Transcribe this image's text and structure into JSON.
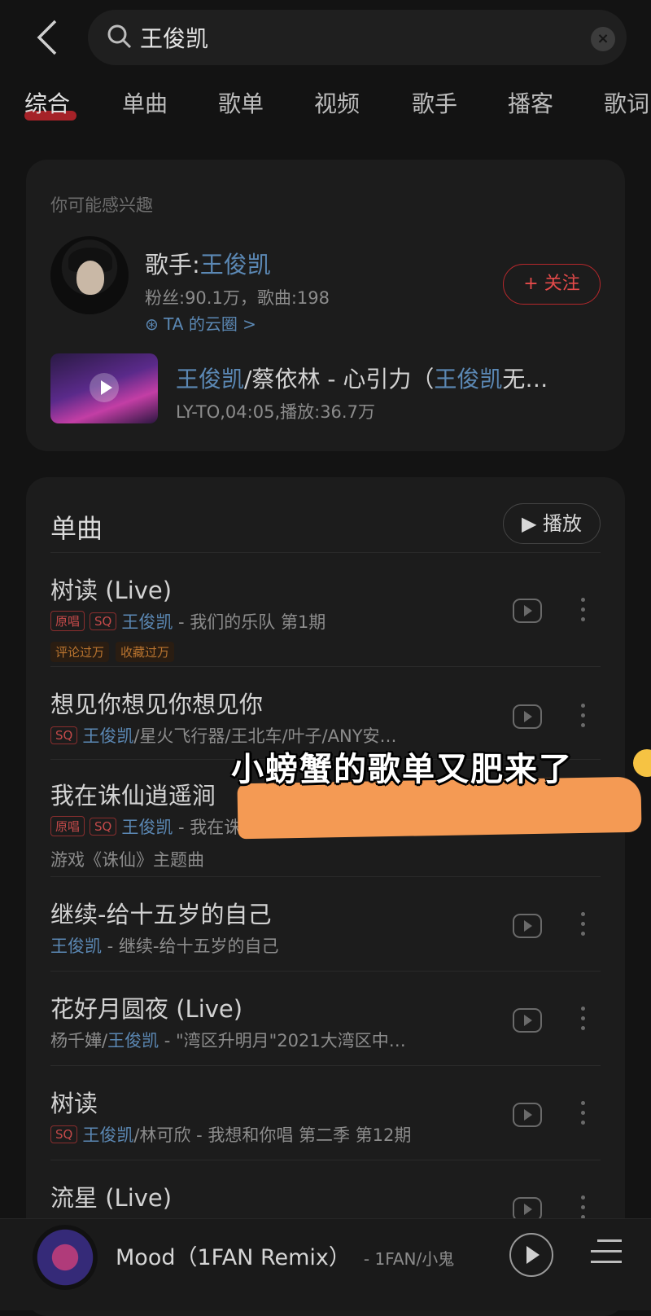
{
  "search": {
    "query": "王俊凯"
  },
  "tabs": [
    "综合",
    "单曲",
    "歌单",
    "视频",
    "歌手",
    "播客",
    "歌词"
  ],
  "interest": {
    "heading": "你可能感兴趣",
    "artist_prefix": "歌手:",
    "artist_name": "王俊凯",
    "artist_stats": "粉丝:90.1万，歌曲:198",
    "circle_link": "TA 的云圈 >",
    "follow_label": "+ 关注",
    "video": {
      "title_a": "王俊凯",
      "title_b": "/蔡依林 - 心引力（",
      "title_c": "王俊凯",
      "title_d": "无…",
      "meta": "LY-TO,04:05,播放:36.7万"
    }
  },
  "songs_section": {
    "heading": "单曲",
    "play_all_label": "▶ 播放",
    "songs": [
      {
        "title": "树读 (Live)",
        "tags": [
          "原唱",
          "SQ"
        ],
        "artist": "王俊凯",
        "rest": " - 我们的乐队 第1期",
        "badges": [
          "评论过万",
          "收藏过万"
        ]
      },
      {
        "title": "想见你想见你想见你",
        "tags": [
          "SQ"
        ],
        "artist": "王俊凯",
        "rest": "/星火飞行器/王北车/叶子/ANY安…"
      },
      {
        "title": "我在诛仙逍遥涧",
        "tags": [
          "原唱",
          "SQ"
        ],
        "artist": "王俊凯",
        "rest": " - 我在诛",
        "note": "游戏《诛仙》主题曲"
      },
      {
        "title": "继续-给十五岁的自己",
        "tags": [],
        "artist": "王俊凯",
        "rest": " - 继续-给十五岁的自己"
      },
      {
        "title": "花好月圆夜 (Live)",
        "tags": [],
        "prefix": "杨千嬅/",
        "artist": "王俊凯",
        "rest": " - \"湾区升明月\"2021大湾区中…"
      },
      {
        "title": "树读",
        "tags": [
          "SQ"
        ],
        "artist": "王俊凯",
        "rest": "/林可欣 - 我想和你唱 第二季 第12期"
      },
      {
        "title": "流星 (Live)",
        "tags": [],
        "artist": "",
        "rest": ""
      }
    ]
  },
  "overlay": {
    "text": "小螃蟹的歌单又肥来了"
  },
  "player": {
    "title": "Mood（1FAN Remix）",
    "artist": "- 1FAN/小鬼"
  },
  "colors": {
    "accent": "#c0262d",
    "link": "#5b88b4",
    "background": "#131313",
    "card": "#1c1c1c",
    "sticker": "#f49a54"
  }
}
